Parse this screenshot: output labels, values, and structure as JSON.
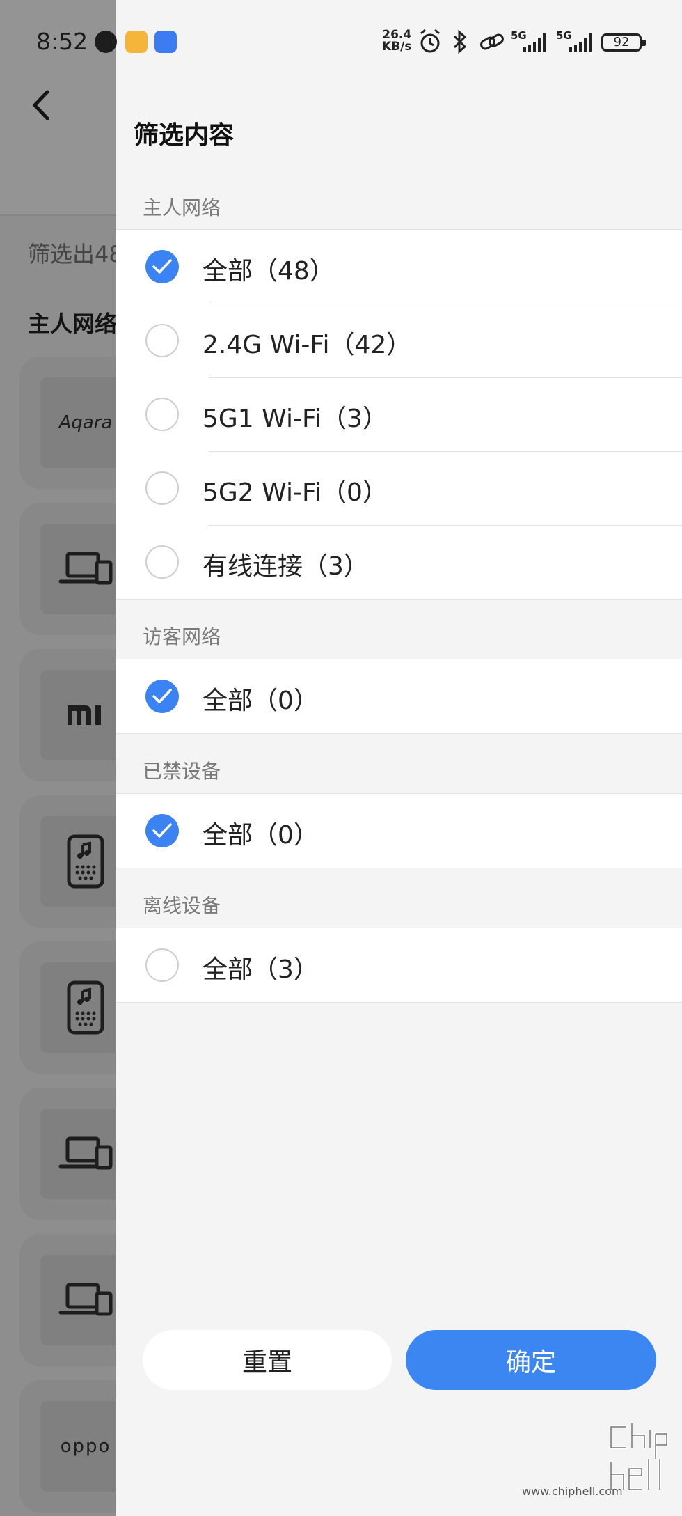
{
  "status_bar": {
    "time": "8:52",
    "net_speed_value": "26.4",
    "net_speed_unit": "KB/s",
    "sim1_label": "5G",
    "sim2_label": "5G",
    "battery": "92"
  },
  "background_page": {
    "count_text": "筛选出48",
    "section_title": "主人网络",
    "logos": [
      "Aqara",
      "oppo"
    ]
  },
  "drawer": {
    "title": "筛选内容",
    "groups": [
      {
        "label": "主人网络",
        "options": [
          {
            "label": "全部（48）",
            "checked": true
          },
          {
            "label": "2.4G Wi-Fi（42）",
            "checked": false
          },
          {
            "label": "5G1 Wi-Fi（3）",
            "checked": false
          },
          {
            "label": "5G2 Wi-Fi（0）",
            "checked": false
          },
          {
            "label": "有线连接（3）",
            "checked": false
          }
        ]
      },
      {
        "label": "访客网络",
        "options": [
          {
            "label": "全部（0）",
            "checked": true
          }
        ]
      },
      {
        "label": "已禁设备",
        "options": [
          {
            "label": "全部（0）",
            "checked": true
          }
        ]
      },
      {
        "label": "离线设备",
        "options": [
          {
            "label": "全部（3）",
            "checked": false
          }
        ]
      }
    ],
    "reset_label": "重置",
    "confirm_label": "确定"
  },
  "watermark": {
    "url": "www.chiphell.com"
  },
  "colors": {
    "accent": "#3b86f1",
    "checked": "#3b82f2"
  }
}
